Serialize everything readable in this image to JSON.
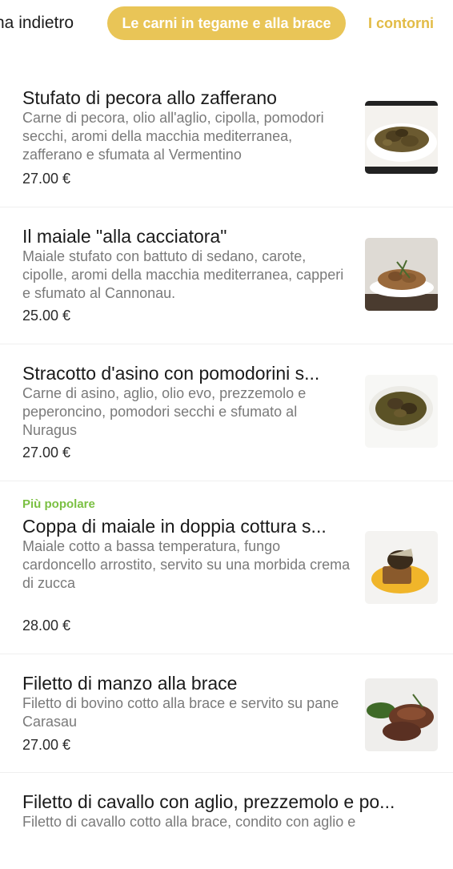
{
  "tabs": {
    "prev": "na indietro",
    "active": "Le carni in tegame e alla brace",
    "next": "I contorni"
  },
  "items": [
    {
      "badge": "",
      "title": "Stufato di pecora allo zafferano",
      "description": "Carne di pecora, olio all'aglio, cipolla, pomodori secchi, aromi della macchia mediterranea, zafferano e sfumata al Vermentino",
      "price": "27.00 €"
    },
    {
      "badge": "",
      "title": "Il maiale \"alla cacciatora\"",
      "description": "Maiale stufato con battuto di sedano, carote, cipolle, aromi della macchia mediterranea, capperi e sfumato al Cannonau.",
      "price": "25.00 €"
    },
    {
      "badge": "",
      "title": "Stracotto d'asino con pomodorini s...",
      "description": "Carne di asino, aglio, olio evo, prezzemolo e peperoncino, pomodori secchi e sfumato al Nuragus",
      "price": "27.00 €"
    },
    {
      "badge": "Più popolare",
      "title": "Coppa di maiale in doppia cottura s...",
      "description": "Maiale cotto a bassa temperatura, fungo cardoncello arrostito, servito su una morbida crema di zucca",
      "price": "28.00 €"
    },
    {
      "badge": "",
      "title": "Filetto di manzo alla brace",
      "description": "Filetto di bovino cotto alla brace e servito su pane Carasau",
      "price": "27.00 €"
    },
    {
      "badge": "",
      "title": "Filetto di cavallo con aglio, prezzemolo e po...",
      "description": "Filetto di cavallo cotto alla brace, condito con aglio e",
      "price": ""
    }
  ]
}
